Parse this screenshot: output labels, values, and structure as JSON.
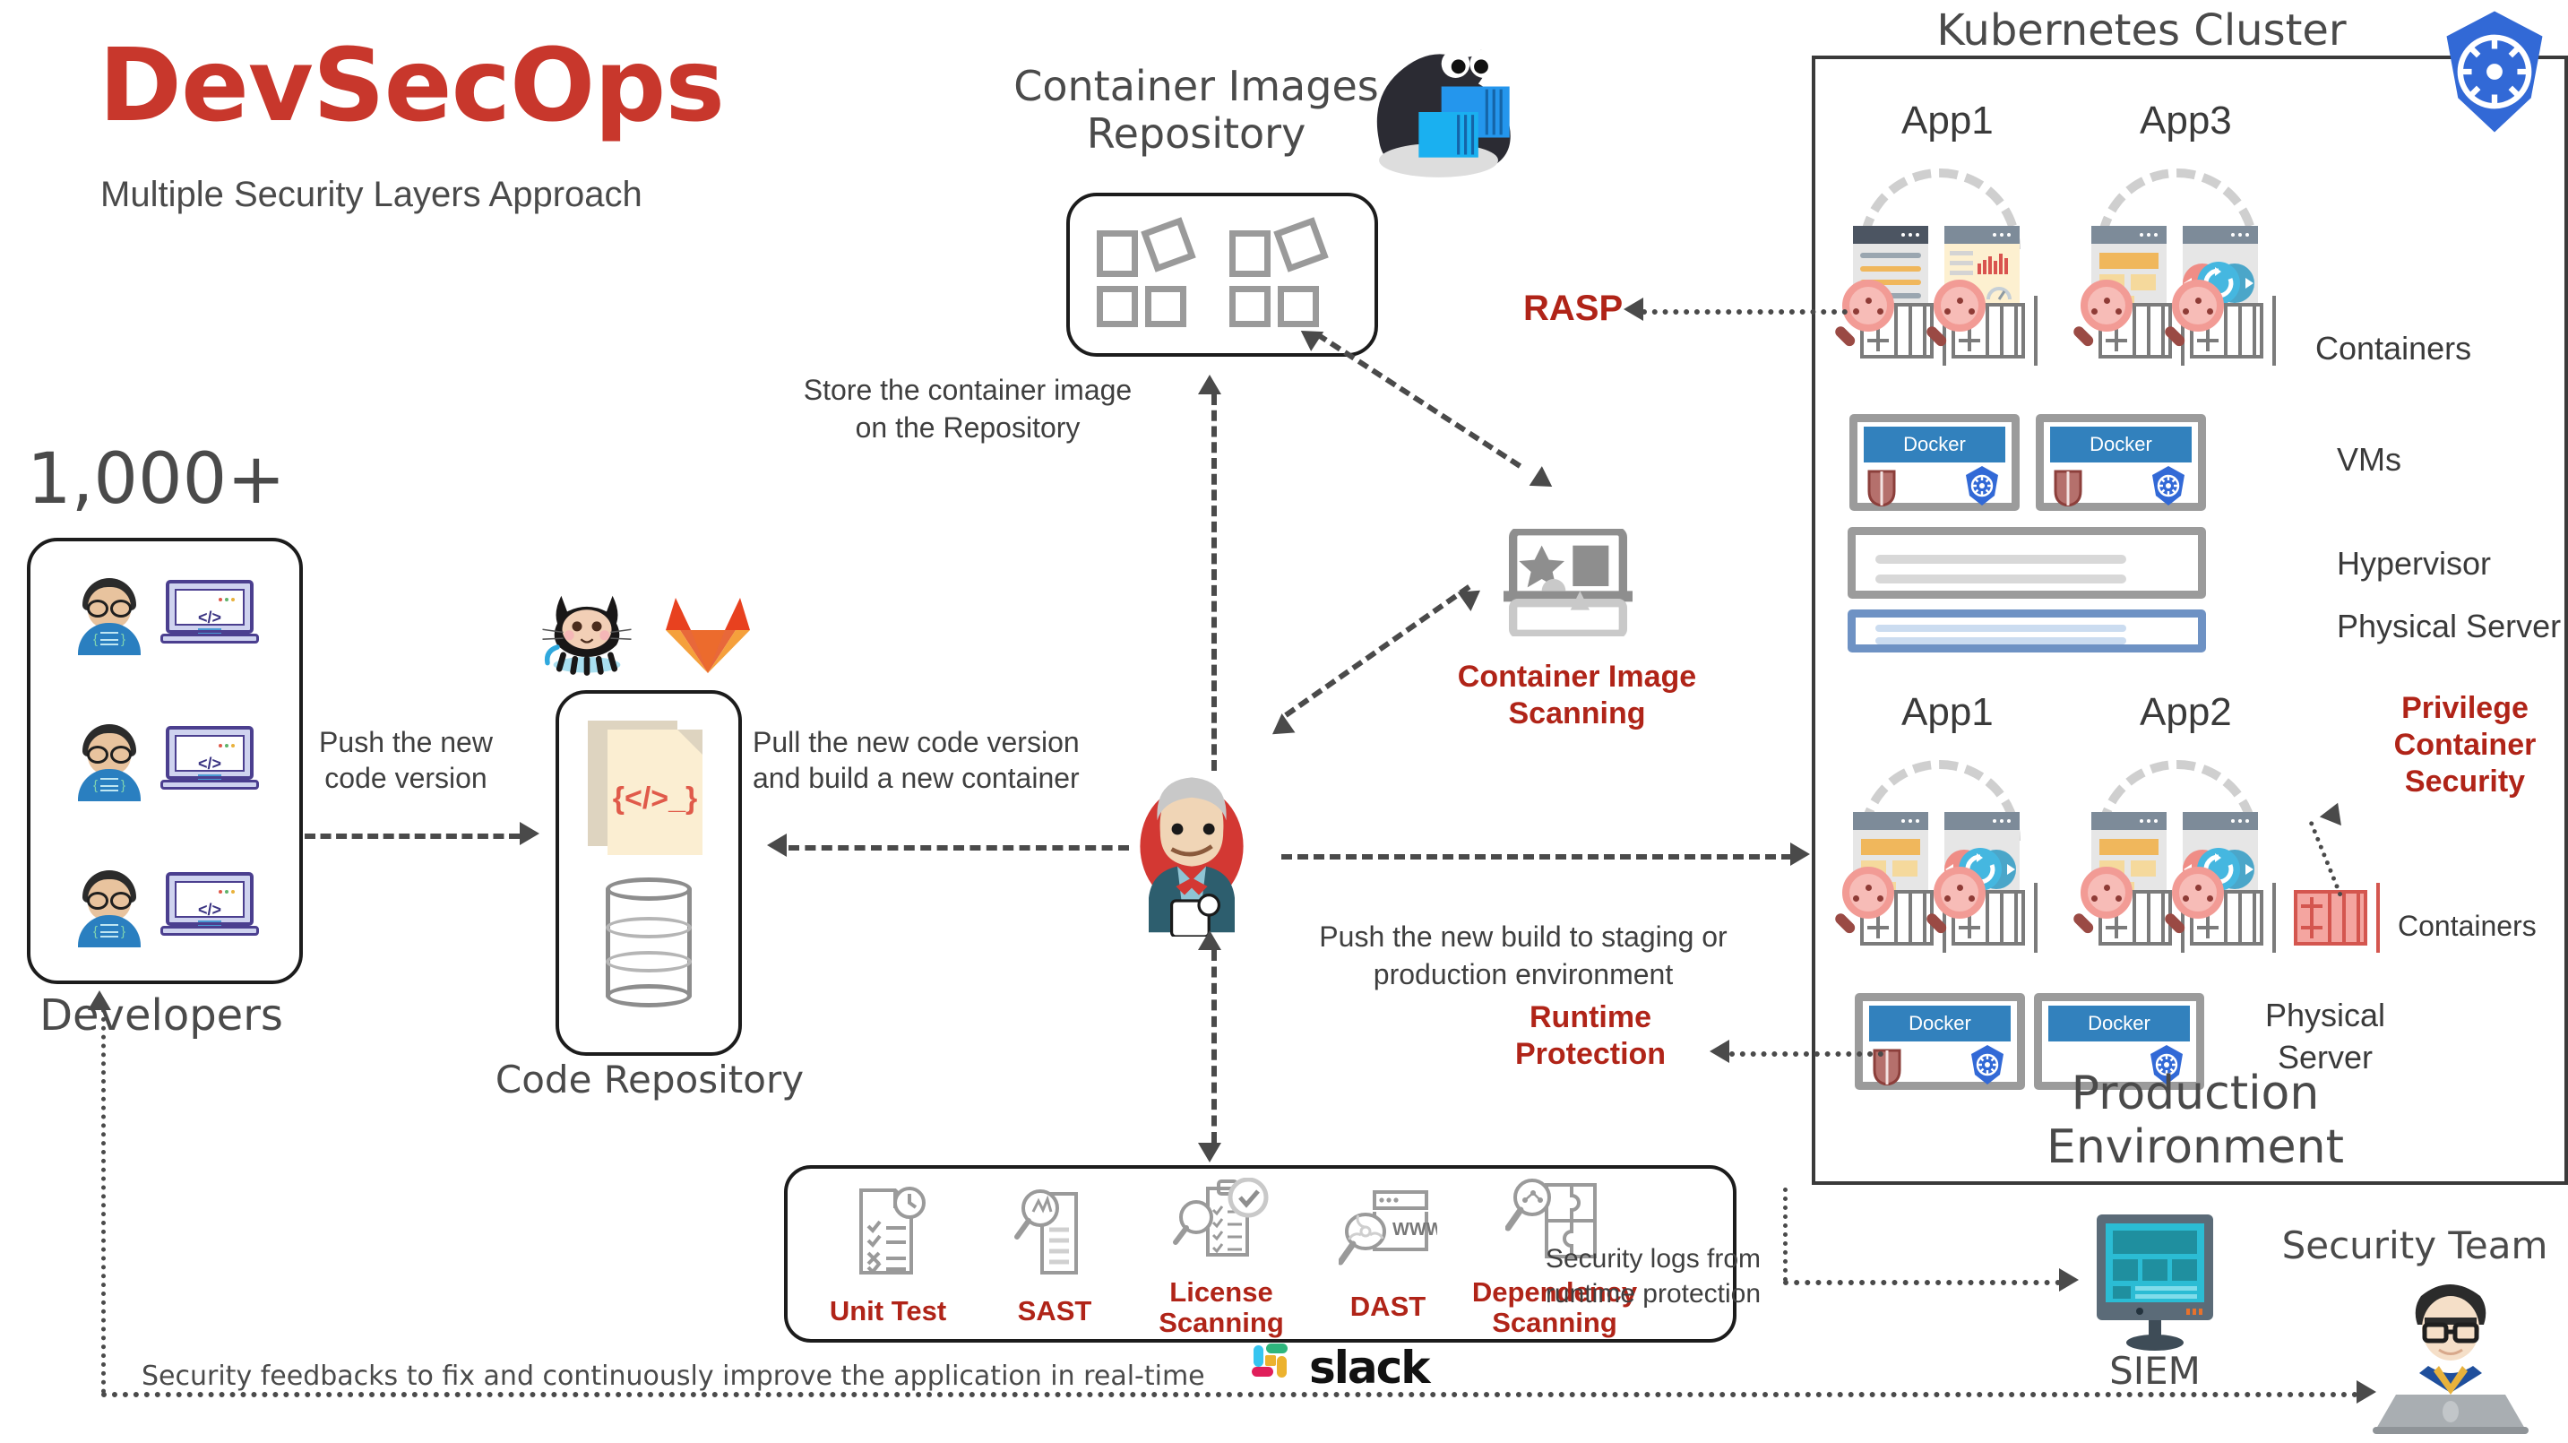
{
  "header": {
    "title": "DevSecOps",
    "subtitle": "Multiple Security Layers Approach",
    "title_color": "#C8372C"
  },
  "colors": {
    "red_accent": "#B02418",
    "text_gray": "#4a4a4a",
    "docker_blue": "#3281bd",
    "k8s_blue": "#3269d6"
  },
  "developers": {
    "count": "1,000+",
    "label": "Developers",
    "laptop_code_tag": "</>",
    "rows": 3
  },
  "flow_labels": {
    "push_code": "Push the new\ncode version",
    "push_code_line1": "Push the new",
    "push_code_line2": "code version",
    "pull_build_line1": "Pull the new code version",
    "pull_build_line2": "and build a new container",
    "store_image_line1": "Store the container image",
    "store_image_line2": "on the Repository",
    "push_build_line1": "Push the new build to staging or",
    "push_build_line2": "production environment",
    "security_logs_line1": "Security logs from",
    "security_logs_line2": "runtime protection",
    "feedback": "Security feedbacks to fix and continuously improve the application in real-time"
  },
  "code_repository": {
    "label": "Code Repository",
    "file_code_glyph": "{</>_}",
    "vcs_icons": [
      "github-octocat-icon",
      "gitlab-fox-icon"
    ]
  },
  "container_repository": {
    "title_line1": "Container Images",
    "title_line2": "Repository",
    "mascot": "docker-whale-icon"
  },
  "security_gates": {
    "container_image_scanning_line1": "Container Image",
    "container_image_scanning_line2": "Scanning",
    "rasp": "RASP",
    "runtime_protection_line1": "Runtime",
    "runtime_protection_line2": "Protection",
    "privilege_container_security_line1": "Privilege",
    "privilege_container_security_line2": "Container",
    "privilege_container_security_line3": "Security"
  },
  "ci_server": {
    "icon": "jenkins-butler-icon"
  },
  "tools": [
    {
      "name": "Unit Test",
      "name_line1": "Unit Test",
      "name_line2": "",
      "icon": "checklist-clock-icon"
    },
    {
      "name": "SAST",
      "name_line1": "SAST",
      "name_line2": "",
      "icon": "magnifier-document-icon"
    },
    {
      "name": "License Scanning",
      "name_line1": "License",
      "name_line2": "Scanning",
      "icon": "checklist-approved-icon"
    },
    {
      "name": "DAST",
      "name_line1": "DAST",
      "name_line2": "",
      "icon": "browser-www-biohazard-icon"
    },
    {
      "name": "Dependency Scanning",
      "name_line1": "Dependency",
      "name_line2": "Scanning",
      "icon": "puzzle-magnifier-icon"
    }
  ],
  "kubernetes": {
    "title": "Kubernetes Cluster",
    "logo": "kubernetes-helm-icon",
    "production_environment": "Production Environment",
    "stack_labels": {
      "containers": "Containers",
      "vms": "VMs",
      "hypervisor": "Hypervisor",
      "physical_server": "Physical Server",
      "physical_server_line1": "Physical",
      "physical_server_line2": "Server",
      "containers_bottom": "Containers"
    },
    "cluster_apps": [
      "App1",
      "App3"
    ],
    "prod_apps": [
      "App1",
      "App2"
    ],
    "docker_label": "Docker"
  },
  "monitoring": {
    "siem": "SIEM",
    "security_team": "Security Team",
    "siem_icon": "monitor-dashboard-icon",
    "analyst_icon": "security-analyst-avatar"
  },
  "chat": {
    "brand": "slack",
    "icon": "slack-hash-icon"
  }
}
